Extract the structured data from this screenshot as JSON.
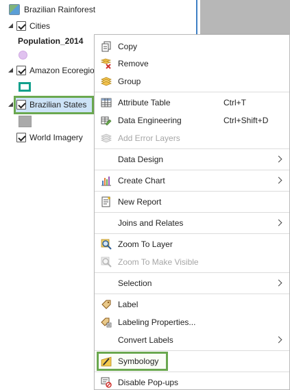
{
  "contents": {
    "map": {
      "label": "Brazilian Rainforest",
      "icon": "map-icon"
    },
    "layers": [
      {
        "label": "Cities",
        "checked": true,
        "expanded": true,
        "symbol_header": "Population_2014",
        "symbol_color": "#e0c2ef"
      },
      {
        "label": "Amazon Ecoregion",
        "checked": true,
        "expanded": true,
        "symbol_color": "#12a08c"
      },
      {
        "label": "Brazilian States",
        "checked": true,
        "expanded": true,
        "selected": true,
        "symbol_color": "#aaaaaa"
      },
      {
        "label": "World Imagery",
        "checked": true,
        "expanded": false
      }
    ]
  },
  "context_menu": {
    "items": [
      {
        "label": "Copy",
        "icon": "copy-icon"
      },
      {
        "label": "Remove",
        "icon": "remove-icon"
      },
      {
        "label": "Group",
        "icon": "group-icon"
      },
      {
        "label": "Attribute Table",
        "icon": "table-icon",
        "shortcut": "Ctrl+T"
      },
      {
        "label": "Data Engineering",
        "icon": "data-engineering-icon",
        "shortcut": "Ctrl+Shift+D"
      },
      {
        "label": "Add Error Layers",
        "icon": "error-layers-icon",
        "disabled": true
      },
      {
        "label": "Data Design",
        "submenu": true
      },
      {
        "label": "Create Chart",
        "icon": "chart-icon",
        "submenu": true
      },
      {
        "label": "New Report",
        "icon": "report-icon"
      },
      {
        "label": "Joins and Relates",
        "submenu": true
      },
      {
        "label": "Zoom To Layer",
        "icon": "zoom-layer-icon"
      },
      {
        "label": "Zoom To Make Visible",
        "icon": "zoom-visible-icon",
        "disabled": true
      },
      {
        "label": "Selection",
        "submenu": true
      },
      {
        "label": "Label",
        "icon": "label-icon"
      },
      {
        "label": "Labeling Properties...",
        "icon": "labeling-properties-icon"
      },
      {
        "label": "Convert Labels",
        "submenu": true
      },
      {
        "label": "Symbology",
        "icon": "symbology-icon",
        "highlighted": true
      },
      {
        "label": "Disable Pop-ups",
        "icon": "disable-popups-icon"
      }
    ]
  },
  "colors": {
    "highlight_outline": "#6aa84f",
    "selection_fill": "#cde3f7",
    "pane_border": "#3d7fc4"
  }
}
